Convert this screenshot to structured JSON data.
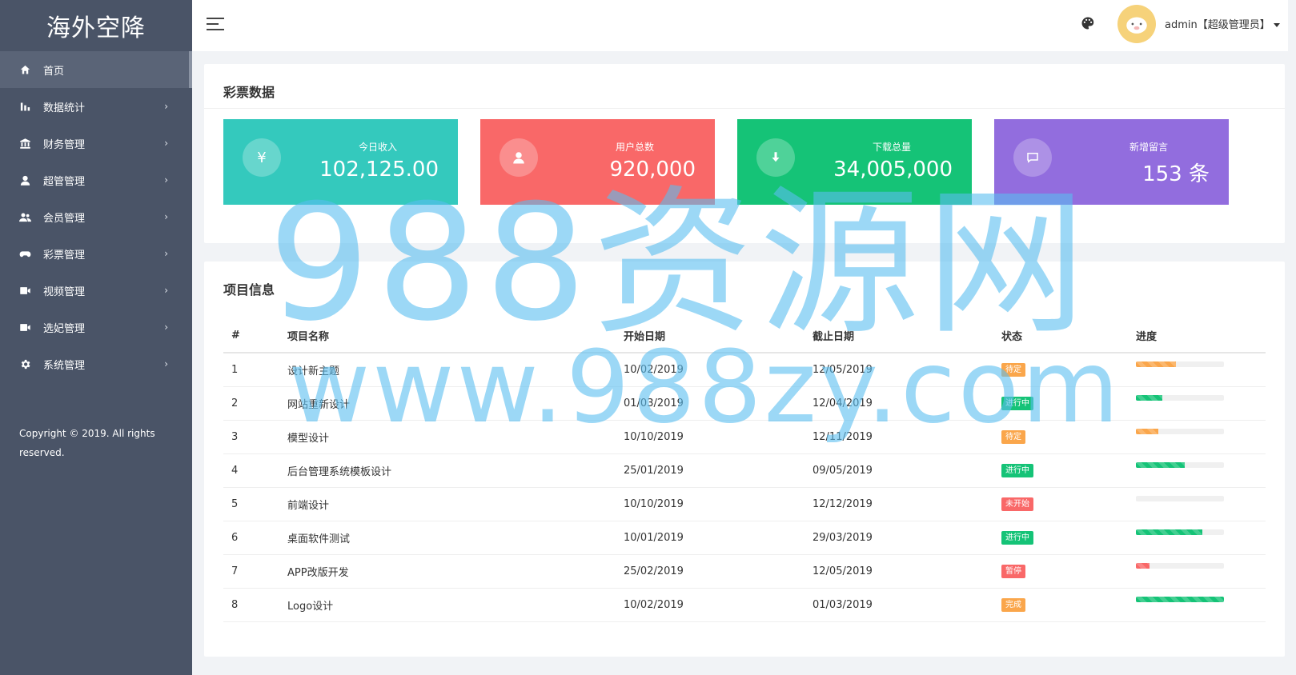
{
  "brand": "海外空降",
  "sidebar": {
    "items": [
      {
        "label": "首页",
        "icon": "home-icon",
        "active": true
      },
      {
        "label": "数据统计",
        "icon": "bar-chart-icon"
      },
      {
        "label": "财务管理",
        "icon": "bank-icon"
      },
      {
        "label": "超管管理",
        "icon": "user-icon"
      },
      {
        "label": "会员管理",
        "icon": "users-icon"
      },
      {
        "label": "彩票管理",
        "icon": "gamepad-icon"
      },
      {
        "label": "视频管理",
        "icon": "video-icon"
      },
      {
        "label": "选妃管理",
        "icon": "video-icon"
      },
      {
        "label": "系统管理",
        "icon": "gear-icon"
      }
    ],
    "copyright": "Copyright © 2019. All rights reserved."
  },
  "header": {
    "user": "admin【超级管理员】"
  },
  "lottery_panel": {
    "title": "彩票数据",
    "stats": [
      {
        "label": "今日收入",
        "value": "102,125.00",
        "icon": "yen-icon",
        "color": "#34c9bd"
      },
      {
        "label": "用户总数",
        "value": "920,000",
        "icon": "user-icon",
        "color": "#f96868"
      },
      {
        "label": "下载总量",
        "value": "34,005,000",
        "icon": "download-icon",
        "color": "#15c377"
      },
      {
        "label": "新增留言",
        "value": "153 条",
        "icon": "comment-icon",
        "color": "#926dde"
      }
    ]
  },
  "project_panel": {
    "title": "项目信息",
    "columns": [
      "#",
      "项目名称",
      "开始日期",
      "截止日期",
      "状态",
      "进度"
    ],
    "rows": [
      {
        "id": "1",
        "name": "设计新主题",
        "start": "10/02/2019",
        "end": "12/05/2019",
        "status": "待定",
        "status_color": "#faa64b",
        "progress": 45,
        "progress_color": "#faa64b"
      },
      {
        "id": "2",
        "name": "网站重新设计",
        "start": "01/03/2019",
        "end": "12/04/2019",
        "status": "进行中",
        "status_color": "#15c377",
        "progress": 30,
        "progress_color": "#15c377"
      },
      {
        "id": "3",
        "name": "模型设计",
        "start": "10/10/2019",
        "end": "12/11/2019",
        "status": "待定",
        "status_color": "#faa64b",
        "progress": 25,
        "progress_color": "#faa64b"
      },
      {
        "id": "4",
        "name": "后台管理系统模板设计",
        "start": "25/01/2019",
        "end": "09/05/2019",
        "status": "进行中",
        "status_color": "#15c377",
        "progress": 55,
        "progress_color": "#15c377"
      },
      {
        "id": "5",
        "name": "前端设计",
        "start": "10/10/2019",
        "end": "12/12/2019",
        "status": "未开始",
        "status_color": "#f96868",
        "progress": 0,
        "progress_color": "#f96868"
      },
      {
        "id": "6",
        "name": "桌面软件测试",
        "start": "10/01/2019",
        "end": "29/03/2019",
        "status": "进行中",
        "status_color": "#15c377",
        "progress": 75,
        "progress_color": "#15c377"
      },
      {
        "id": "7",
        "name": "APP改版开发",
        "start": "25/02/2019",
        "end": "12/05/2019",
        "status": "暂停",
        "status_color": "#f96868",
        "progress": 15,
        "progress_color": "#f96868"
      },
      {
        "id": "8",
        "name": "Logo设计",
        "start": "10/02/2019",
        "end": "01/03/2019",
        "status": "完成",
        "status_color": "#faa64b",
        "progress": 100,
        "progress_color": "#15c377"
      }
    ]
  },
  "watermark": {
    "line1": "988资源网",
    "line2": "www.988zy.com"
  }
}
